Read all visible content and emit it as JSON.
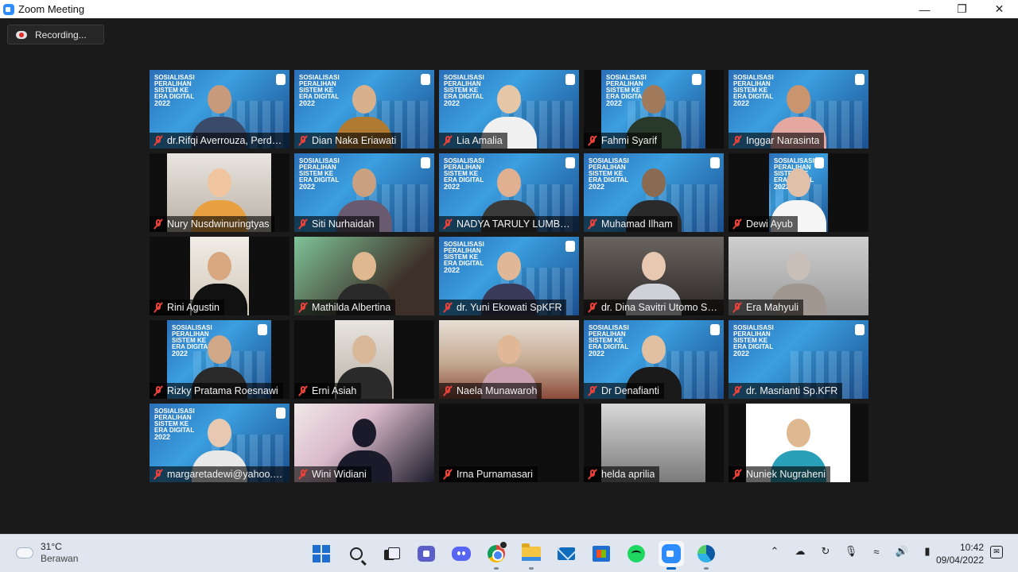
{
  "window": {
    "title": "Zoom Meeting"
  },
  "recording": {
    "label": "Recording..."
  },
  "banner": {
    "line1": "SOSIALISASI",
    "line2": "PERALIHAN",
    "line3": "SISTEM KE",
    "line4": "ERA DIGITAL",
    "year": "2022"
  },
  "participants": [
    {
      "name": "dr.Rifqi Averrouza, Perdo...",
      "bg": "banner",
      "vid": "full",
      "skin": "#c89a7c",
      "cloth": "#3a4a6a"
    },
    {
      "name": "Dian Naka Eriawati",
      "bg": "banner",
      "vid": "full",
      "skin": "#d9b08c",
      "cloth": "#b07a30"
    },
    {
      "name": "Lia Amalia",
      "bg": "banner",
      "vid": "full",
      "skin": "#e5c7a8",
      "cloth": "#f0f0f0"
    },
    {
      "name": "Fahmi Syarif",
      "bg": "banner",
      "vid": "narrow",
      "skin": "#a07a5a",
      "cloth": "#2a3a2a"
    },
    {
      "name": "Inggar Narasinta",
      "bg": "banner",
      "vid": "full",
      "skin": "#c9946e",
      "cloth": "#e5a8a0"
    },
    {
      "name": "Nury Nusdwinuringtyas",
      "bg": "room3",
      "vid": "narrow",
      "skin": "#f0c5a0",
      "cloth": "#e8a040"
    },
    {
      "name": "Siti Nurhaidah",
      "bg": "banner",
      "vid": "full",
      "skin": "#c9a080",
      "cloth": "#6a5a70"
    },
    {
      "name": "NADYA TARULY LUMBAN...",
      "bg": "banner",
      "vid": "full",
      "skin": "#e0b090",
      "cloth": "#3a3a3a"
    },
    {
      "name": "Muhamad Ilham",
      "bg": "banner",
      "vid": "full",
      "skin": "#8a6a50",
      "cloth": "#2a2a2a"
    },
    {
      "name": "Dewi Ayub",
      "bg": "banner",
      "vid": "vnarrow",
      "skin": "#e0c0a8",
      "cloth": "#f5f5f5"
    },
    {
      "name": "Rini Agustin",
      "bg": "room2",
      "vid": "vnarrow",
      "skin": "#d9a880",
      "cloth": "#111111"
    },
    {
      "name": "Mathilda Albertina",
      "bg": "green",
      "vid": "full",
      "skin": "#e0b890",
      "cloth": "#2a2a2a"
    },
    {
      "name": "dr. Yuni Ekowati SpKFR",
      "bg": "banner",
      "vid": "full",
      "skin": "#e0b898",
      "cloth": "#3a3a5a"
    },
    {
      "name": "dr. Dina Savitri Utomo Sp...",
      "bg": "car",
      "vid": "full",
      "skin": "#e8c8b0",
      "cloth": "#d0d0d8"
    },
    {
      "name": "Era Mahyuli",
      "bg": "gray",
      "vid": "full",
      "skin": "#c8c0b8",
      "cloth": "#a09890"
    },
    {
      "name": "Rizky Pratama Roesnawi",
      "bg": "banner",
      "vid": "narrow",
      "skin": "#d0a888",
      "cloth": "#2a2a2a"
    },
    {
      "name": "Erni Asiah",
      "bg": "room3",
      "vid": "vnarrow",
      "skin": "#d8b898",
      "cloth": "#2a2a2a"
    },
    {
      "name": "Naela Munawaroh",
      "bg": "sofa",
      "vid": "full",
      "skin": "#e0b898",
      "cloth": "#c8a0b0"
    },
    {
      "name": "Dr Denafianti",
      "bg": "banner",
      "vid": "full",
      "skin": "#e0c0a0",
      "cloth": "#1a1a1a"
    },
    {
      "name": "dr. Masrianti Sp.KFR",
      "bg": "banner",
      "vid": "full",
      "skin": "",
      "cloth": ""
    },
    {
      "name": "margaretadewi@yahoo.c...",
      "bg": "banner",
      "vid": "full",
      "skin": "#e8c8b0",
      "cloth": "#e8e8e8"
    },
    {
      "name": "Wini Widiani",
      "bg": "pink",
      "vid": "full",
      "skin": "#1a1a2a",
      "cloth": "#1a1a2a"
    },
    {
      "name": "Irna Purnamasari",
      "bg": "none",
      "vid": "full",
      "skin": "",
      "cloth": ""
    },
    {
      "name": "helda aprilia",
      "bg": "fog",
      "vid": "narrow",
      "skin": "",
      "cloth": ""
    },
    {
      "name": "Nuniek Nugraheni",
      "bg": "white",
      "vid": "narrow",
      "skin": "#e0b890",
      "cloth": "#2aa0b8"
    }
  ],
  "taskbar": {
    "weather": {
      "temp": "31°C",
      "desc": "Berawan"
    },
    "apps": [
      "windows-start",
      "search",
      "task-view",
      "teams-chat",
      "discord",
      "chrome",
      "file-explorer",
      "mail",
      "microsoft-store",
      "spotify",
      "zoom",
      "edge"
    ],
    "clock": {
      "time": "10:42",
      "date": "09/04/2022"
    },
    "tray": [
      "chevron-up",
      "onedrive",
      "sync",
      "microphone",
      "wifi",
      "volume",
      "battery"
    ]
  },
  "colors": {
    "accent": "#2d8cff",
    "mute": "#e8423a",
    "stage": "#1a1a1a",
    "taskbar": "#dfe6ef"
  }
}
